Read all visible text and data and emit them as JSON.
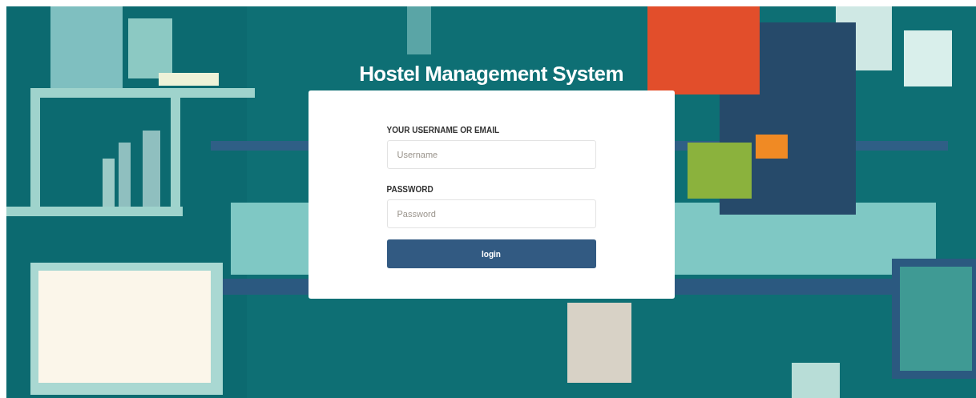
{
  "title": "Hostel Management System",
  "form": {
    "username": {
      "label": "YOUR USERNAME OR EMAIL",
      "placeholder": "Username"
    },
    "password": {
      "label": "PASSWORD",
      "placeholder": "Password"
    },
    "submit": "login"
  }
}
